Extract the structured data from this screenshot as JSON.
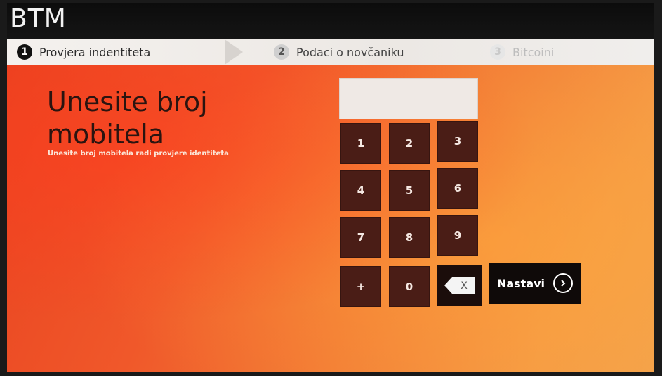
{
  "brand": "BTM",
  "steps": [
    {
      "number": "1",
      "label": "Provjera indentiteta",
      "state": "active"
    },
    {
      "number": "2",
      "label": "Podaci o novčaniku",
      "state": "pending"
    },
    {
      "number": "3",
      "label": "Bitcoini",
      "state": "pending"
    }
  ],
  "page": {
    "title_line1": "Unesite broj",
    "title_line2": "mobitela",
    "subtitle": "Unesite broj mobitela radi provjere identiteta"
  },
  "phone_input": {
    "value": ""
  },
  "keypad": {
    "keys": [
      "1",
      "2",
      "3",
      "4",
      "5",
      "6",
      "7",
      "8",
      "9",
      "+",
      "0"
    ],
    "backspace_label": "X"
  },
  "next_button": {
    "label": "Nastavi",
    "icon": "chevron-right-circle-icon"
  },
  "colors": {
    "background_start": "#e8401f",
    "background_end": "#f3a24c",
    "key_bg": "#4a1d16",
    "topbar_bg": "#0c0c0c",
    "steps_bg": "#f4f1ee"
  }
}
